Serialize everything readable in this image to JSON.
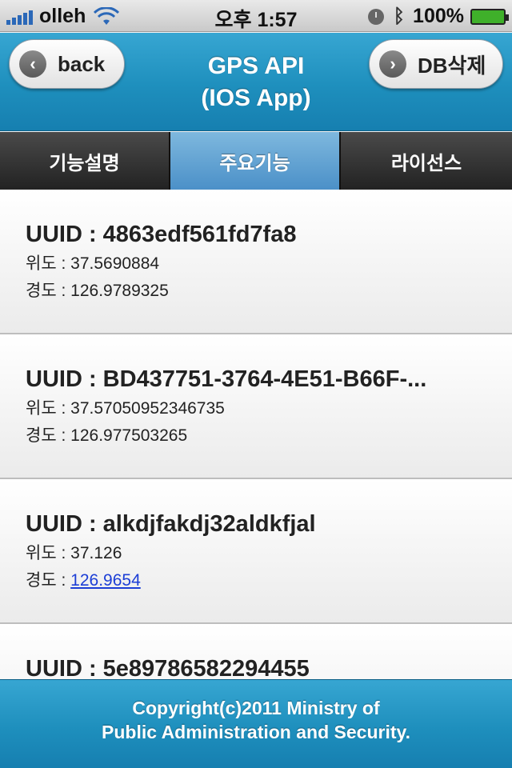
{
  "status_bar": {
    "carrier": "olleh",
    "time": "오후 1:57",
    "battery": "100%"
  },
  "header": {
    "back_label": "back",
    "title_line1": "GPS API",
    "title_line2": "(IOS App)",
    "db_delete_label": "DB삭제"
  },
  "tabs": [
    {
      "label": "기능설명"
    },
    {
      "label": "주요기능"
    },
    {
      "label": "라이선스"
    }
  ],
  "items": [
    {
      "uuid": "UUID : 4863edf561fd7fa8",
      "lat": "위도 : 37.5690884",
      "lng_prefix": "경도 : ",
      "lng_value": "126.9789325"
    },
    {
      "uuid": "UUID : BD437751-3764-4E51-B66F-...",
      "lat": "위도 : 37.57050952346735",
      "lng_prefix": "경도 : ",
      "lng_value": "126.977503265"
    },
    {
      "uuid": "UUID : alkdjfakdj32aldkfjal",
      "lat": "위도 : 37.126",
      "lng_prefix": "경도 : ",
      "lng_value": "126.9654"
    },
    {
      "uuid": "UUID : 5e89786582294455",
      "lat": "",
      "lng_prefix": "",
      "lng_value": ""
    }
  ],
  "footer": {
    "line1": "Copyright(c)2011 Ministry of",
    "line2": "Public Administration and Security."
  }
}
